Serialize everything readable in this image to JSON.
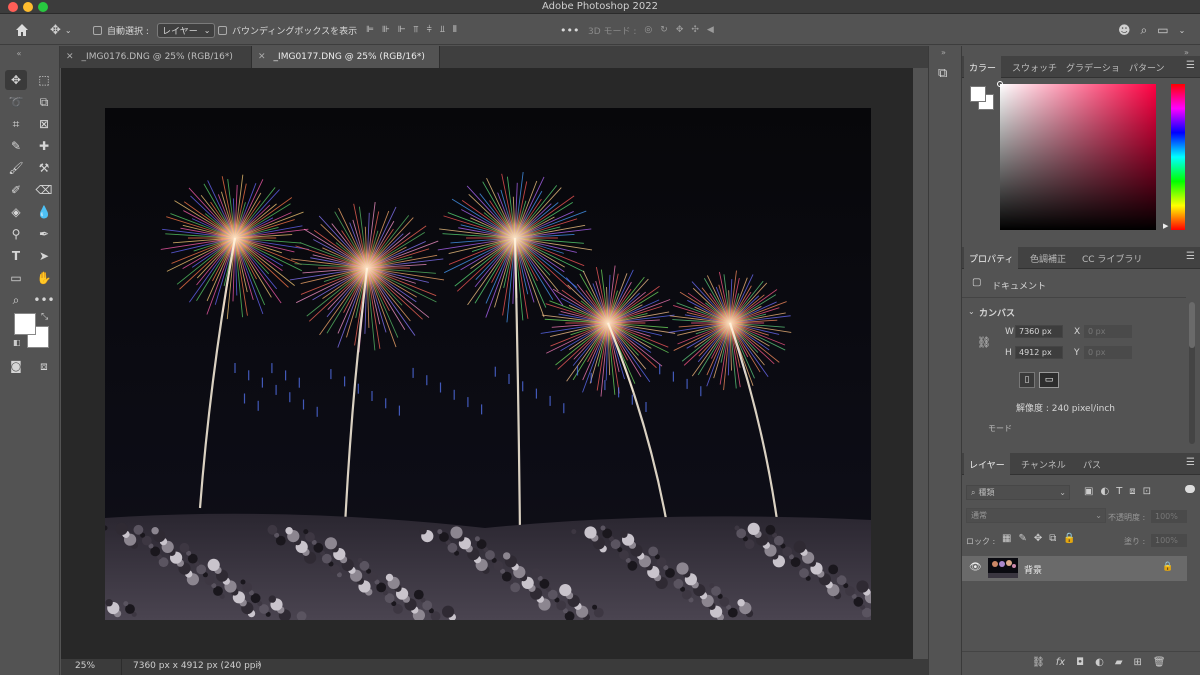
{
  "window": {
    "title": "Adobe Photoshop 2022"
  },
  "options_bar": {
    "auto_select_label": "自動選択 :",
    "auto_select_value": "レイヤー",
    "bounding_box_label": "バウンディングボックスを表示",
    "more_label": "•••",
    "mode_3d_label": "3D モード :"
  },
  "tabs": [
    {
      "label": "_IMG0176.DNG @ 25% (RGB/16*)",
      "active": false
    },
    {
      "label": "_IMG0177.DNG @ 25% (RGB/16*)",
      "active": true
    }
  ],
  "status": {
    "zoom": "25%",
    "info": "7360 px x 4912 px (240 ppi)",
    "arrow": "›"
  },
  "color_panel": {
    "tabs": [
      "カラー",
      "スウォッチ",
      "グラデーショ",
      "パターン"
    ],
    "active_tab": "カラー"
  },
  "properties_panel": {
    "tabs": [
      "プロパティ",
      "色調補正",
      "CC ライブラリ"
    ],
    "document_label": "ドキュメント",
    "canvas_label": "カンバス",
    "width_label": "W",
    "width_value": "7360 px",
    "height_label": "H",
    "height_value": "4912 px",
    "x_label": "X",
    "x_placeholder": "0 px",
    "y_label": "Y",
    "y_placeholder": "0 px",
    "resolution": "解像度 : 240 pixel/inch",
    "mode_label": "モード"
  },
  "layers_panel": {
    "tabs": [
      "レイヤー",
      "チャンネル",
      "パス"
    ],
    "filter_placeholder": "種類",
    "blend_mode": "通常",
    "opacity_label": "不透明度 :",
    "opacity_value": "100%",
    "lock_label": "ロック :",
    "fill_label": "塗り :",
    "fill_value": "100%",
    "layers": [
      {
        "name": "背景",
        "visible": true,
        "locked": true
      }
    ]
  },
  "colors": {
    "accent_fg": "#ffffff",
    "accent_bg": "#ffffff",
    "panel_bg": "#535353",
    "canvas_bg": "#282828",
    "picker_hue": "#ff0042"
  }
}
